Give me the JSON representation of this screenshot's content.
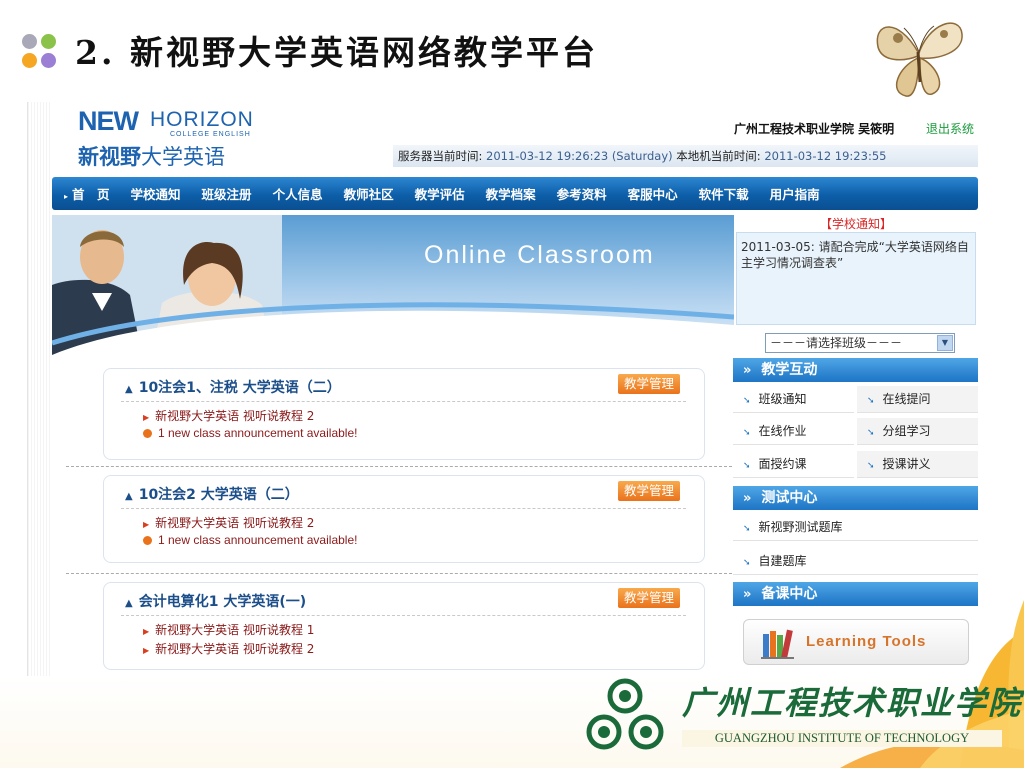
{
  "slide": {
    "title": "2.  新视野大学英语网络教学平台",
    "footer_logo_cn": "广州工程技术职业学院",
    "footer_logo_en": "GUANGZHOU INSTITUTE OF TECHNOLOGY"
  },
  "portal": {
    "logo": {
      "new": "NEW",
      "horizon": "HORIZON",
      "college": "COLLEGE ENGLISH",
      "cn_bold": "新视野",
      "cn_rest": "大学英语"
    },
    "user": {
      "institution_and_name": "广州工程技术职业学院 吴筱明",
      "logout": "退出系统"
    },
    "time_bar": {
      "server_label": "服务器当前时间:",
      "server_time": "2011-03-12 19:26:23 (Saturday)",
      "local_label": "本地机当前时间:",
      "local_time": "2011-03-12 19:23:55"
    },
    "nav": [
      "首　页",
      "学校通知",
      "班级注册",
      "个人信息",
      "教师社区",
      "教学评估",
      "教学档案",
      "参考资料",
      "客服中心",
      "软件下载",
      "用户指南"
    ],
    "banner_title": "Online Classroom",
    "courses": [
      {
        "title": "10注会1、注税  大学英语（二）",
        "button": "教学管理",
        "link": "新视野大学英语 视听说教程 2",
        "announcement": "1 new class announcement available!"
      },
      {
        "title": "10注会2  大学英语（二）",
        "button": "教学管理",
        "link": "新视野大学英语 视听说教程 2",
        "announcement": "1 new class announcement available!"
      },
      {
        "title": "会计电算化1  大学英语(一)",
        "button": "教学管理",
        "link": "新视野大学英语 视听说教程 1",
        "link2": "新视野大学英语 视听说教程 2"
      }
    ],
    "notice": {
      "heading": "【学校通知】",
      "text": "2011-03-05: 请配合完成“大学英语网络自主学习情况调查表”"
    },
    "class_select": "－－－请选择班级－－－",
    "interaction": {
      "heading": "教学互动",
      "items": [
        "班级通知",
        "在线提问",
        "在线作业",
        "分组学习",
        "面授约课",
        "授课讲义"
      ]
    },
    "test_center": {
      "heading": "测试中心",
      "items": [
        "新视野测试题库",
        "自建题库"
      ]
    },
    "prep_center": {
      "heading": "备课中心",
      "tools_label": "Learning Tools"
    }
  },
  "colors": {
    "nav_blue": "#0d5ea8",
    "accent_orange": "#e9731c",
    "title_blue": "#1c4f8a",
    "link_red": "#8b1a1a",
    "logo_green": "#1a6a3a"
  }
}
